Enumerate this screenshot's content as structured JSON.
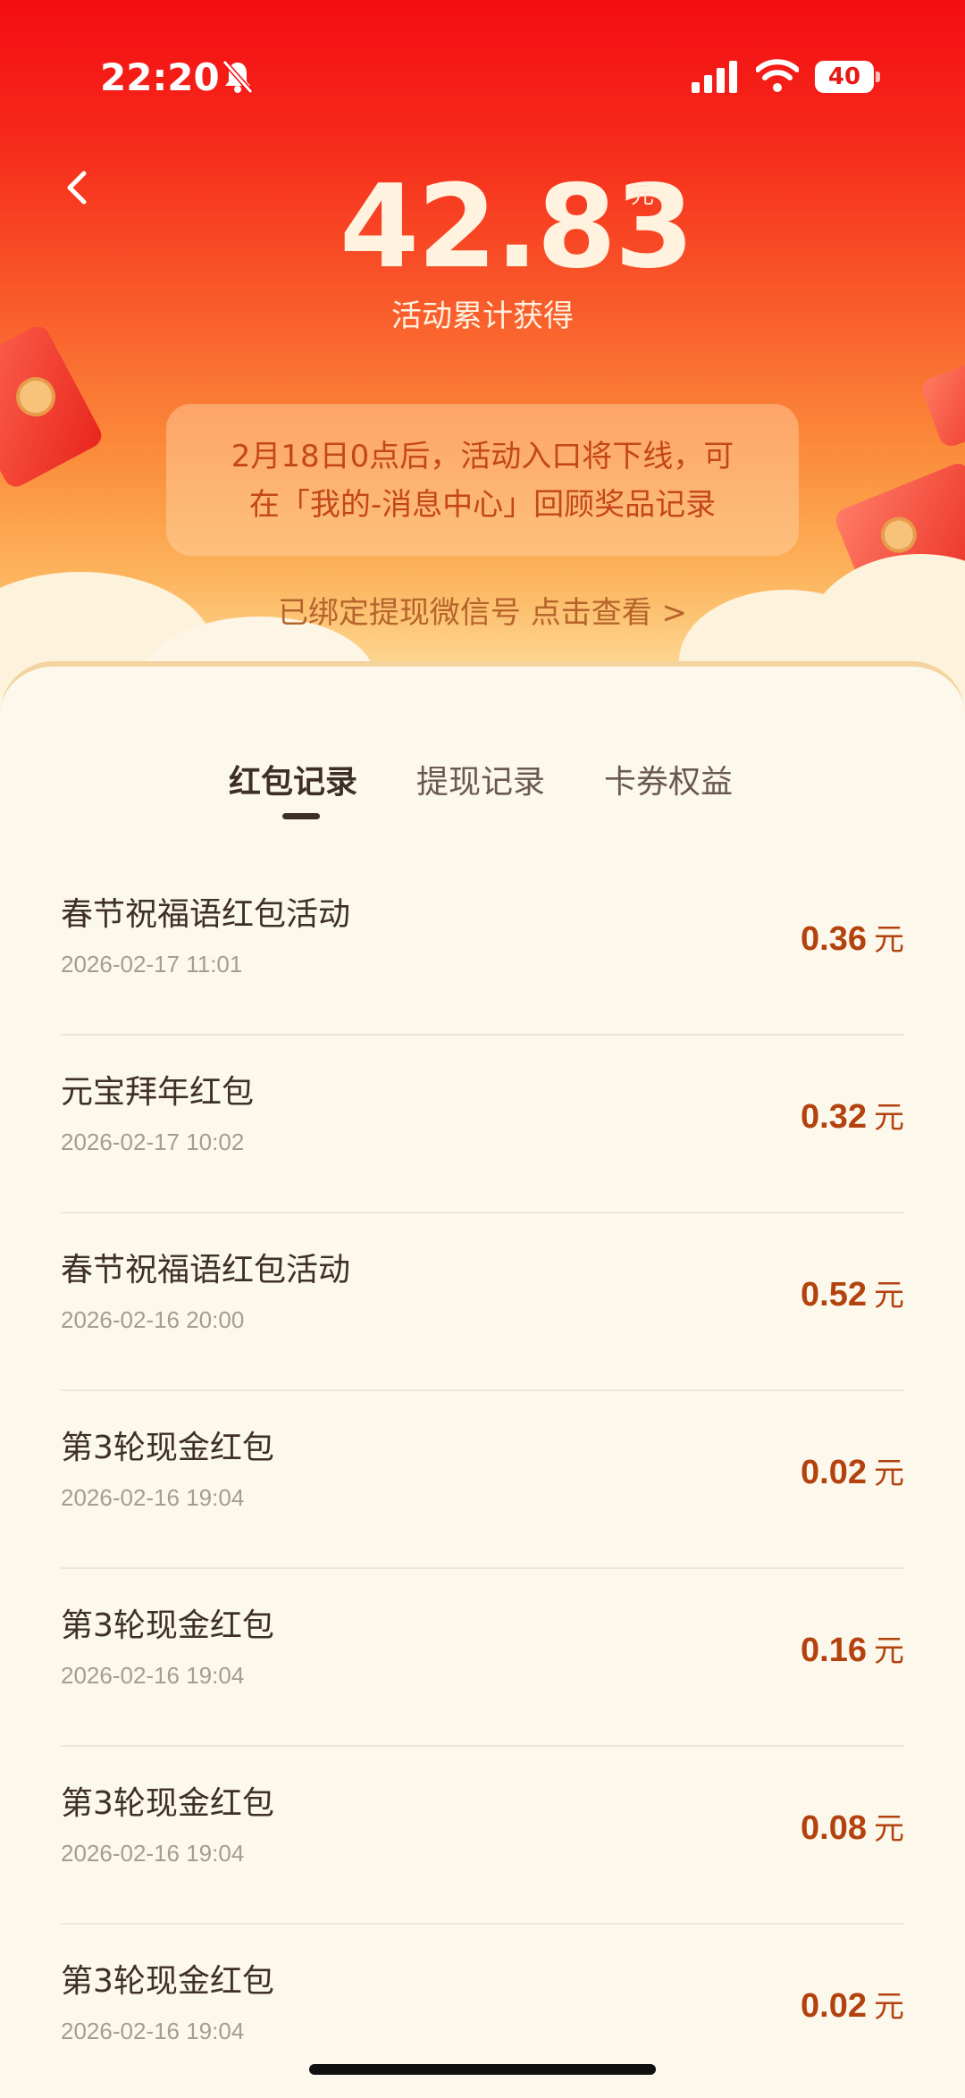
{
  "status_bar": {
    "time": "22:20",
    "battery": "40"
  },
  "summary": {
    "amount": "42.83",
    "unit": "元",
    "label": "活动累计获得",
    "notice_line1": "2月18日0点后，活动入口将下线，可",
    "notice_line2": "在「我的-消息中心」回顾奖品记录",
    "bind_link": "已绑定提现微信号 点击查看 >"
  },
  "tabs": [
    {
      "label": "红包记录",
      "active": true
    },
    {
      "label": "提现记录",
      "active": false
    },
    {
      "label": "卡券权益",
      "active": false
    }
  ],
  "records": [
    {
      "title": "春节祝福语红包活动",
      "date": "2026-02-17 11:01",
      "amount": "0.36",
      "unit": "元"
    },
    {
      "title": "元宝拜年红包",
      "date": "2026-02-17 10:02",
      "amount": "0.32",
      "unit": "元"
    },
    {
      "title": "春节祝福语红包活动",
      "date": "2026-02-16 20:00",
      "amount": "0.52",
      "unit": "元"
    },
    {
      "title": "第3轮现金红包",
      "date": "2026-02-16 19:04",
      "amount": "0.02",
      "unit": "元"
    },
    {
      "title": "第3轮现金红包",
      "date": "2026-02-16 19:04",
      "amount": "0.16",
      "unit": "元"
    },
    {
      "title": "第3轮现金红包",
      "date": "2026-02-16 19:04",
      "amount": "0.08",
      "unit": "元"
    },
    {
      "title": "第3轮现金红包",
      "date": "2026-02-16 19:04",
      "amount": "0.02",
      "unit": "元"
    }
  ],
  "colors": {
    "accent": "#b3420f",
    "hero_top": "#f40d12",
    "background": "#fdf8ec"
  }
}
